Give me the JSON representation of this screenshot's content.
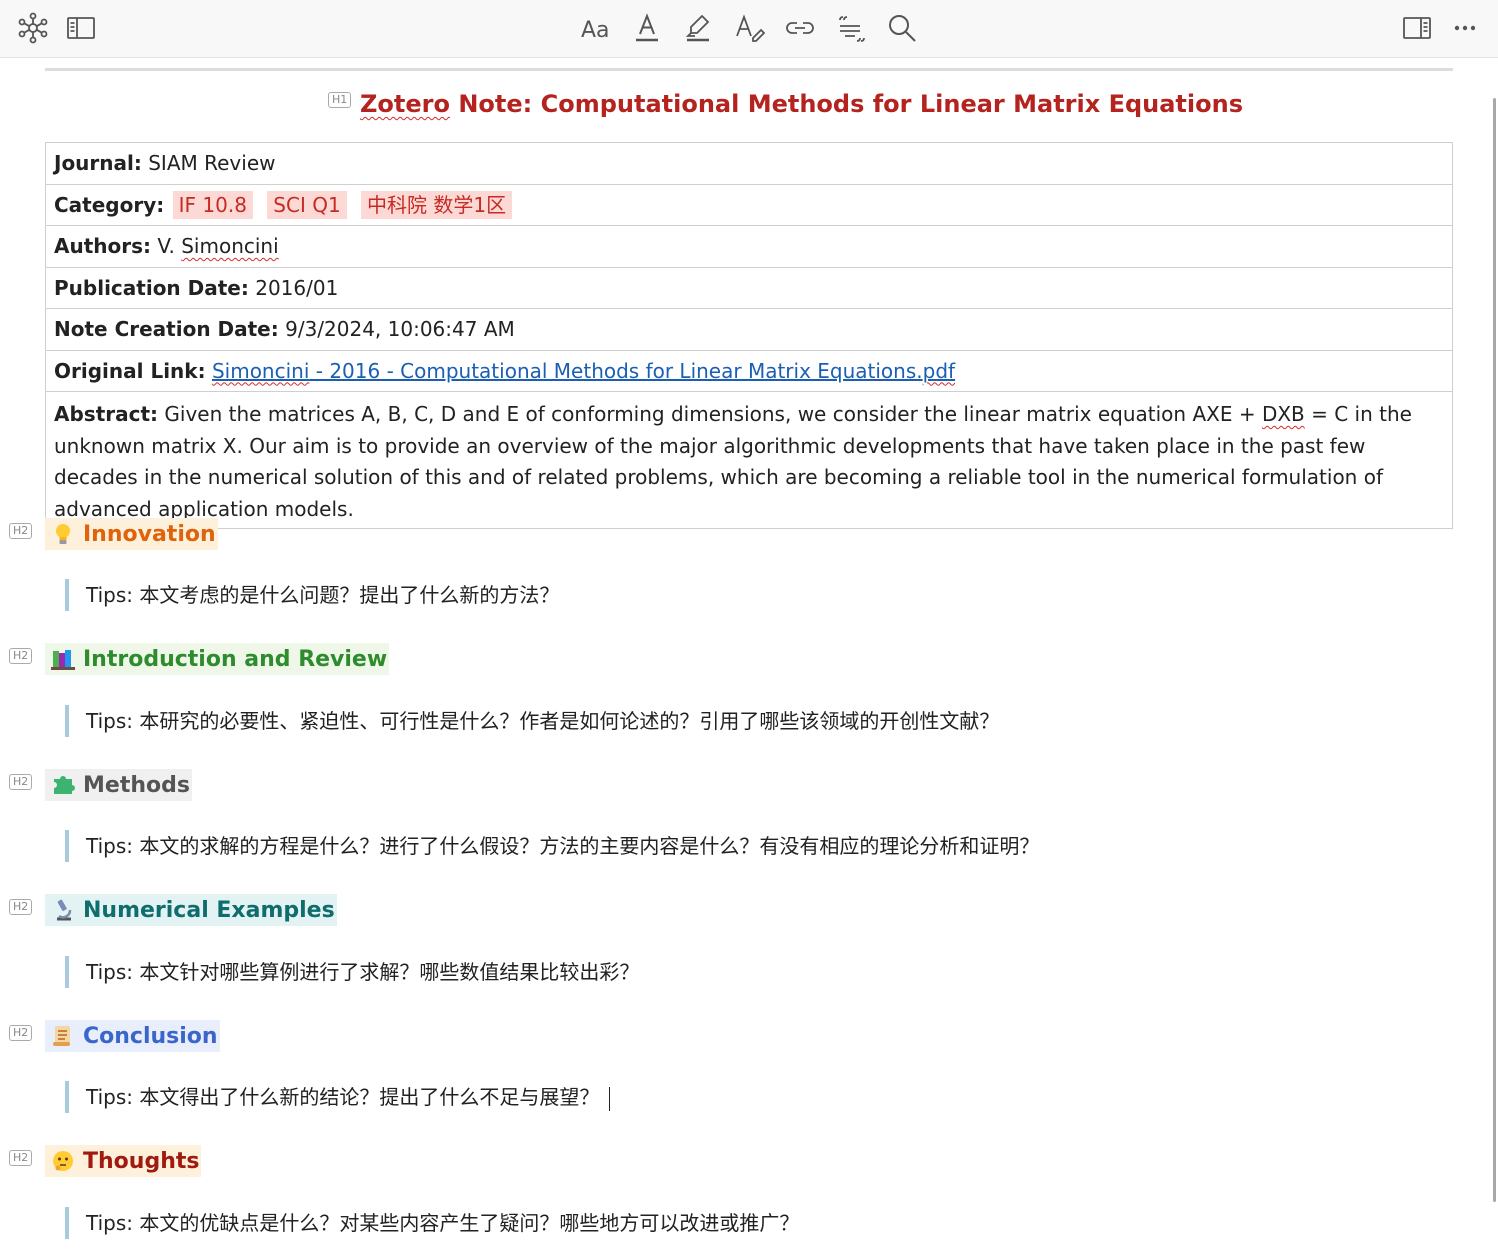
{
  "toolbar": {
    "left": [
      {
        "name": "graph-view-icon"
      },
      {
        "name": "sidebar-toggle-icon"
      }
    ],
    "center": [
      {
        "name": "text-size-icon"
      },
      {
        "name": "text-color-icon"
      },
      {
        "name": "highlight-icon"
      },
      {
        "name": "clear-format-icon"
      },
      {
        "name": "link-icon"
      },
      {
        "name": "citation-icon"
      },
      {
        "name": "search-icon"
      }
    ],
    "right": [
      {
        "name": "context-pane-icon"
      },
      {
        "name": "more-options-icon"
      }
    ]
  },
  "heading_labels": {
    "h1": "H1",
    "h2": "H2"
  },
  "title": {
    "word1": "Zotero",
    "rest": " Note: Computational Methods for Linear Matrix Equations",
    "color": "#b5231f"
  },
  "meta": {
    "journal_label": "Journal:",
    "journal": "SIAM Review",
    "category_label": "Category:",
    "category_tags": [
      "IF 10.8",
      "SCI Q1",
      "中科院 数学1区"
    ],
    "authors_label": "Authors:",
    "authors_prefix": "V. ",
    "authors_name": "Simoncini",
    "pubdate_label": "Publication Date:",
    "pubdate": "2016/01",
    "created_label": "Note Creation Date:",
    "created": "9/3/2024, 10:06:47 AM",
    "link_label": "Original Link:",
    "link_word1": "Simoncini",
    "link_rest": " - 2016 - Computational Methods for Linear Matrix Equations.",
    "link_ext": "pdf",
    "abstract_label": "Abstract:",
    "abstract_pre": " Given the matrices A, B, C, D and E of conforming dimensions, we consider the linear matrix equation AXE + ",
    "abstract_dxb": "DXB",
    "abstract_post": " = C in the unknown matrix X. Our aim is to provide an overview of the major algorithmic developments that have taken place in the past few decades in the numerical solution of this and of related problems, which are becoming a reliable tool in the numerical formulation of advanced application models."
  },
  "sections": [
    {
      "title": "Innovation",
      "icon": "lightbulb-icon",
      "color": "#e0620a",
      "bg": "#fdf1dc",
      "tip": "Tips: 本文考虑的是什么问题？提出了什么新的方法？"
    },
    {
      "title": "Introduction and Review",
      "icon": "books-icon",
      "color": "#2e8b2e",
      "bg": "#eef7e8",
      "tip": "Tips: 本研究的必要性、紧迫性、可行性是什么？作者是如何论述的？引用了哪些该领域的开创性文献？"
    },
    {
      "title": "Methods",
      "icon": "puzzle-icon",
      "color": "#555555",
      "bg": "#f0f0f0",
      "tip": "Tips: 本文的求解的方程是什么？进行了什么假设？方法的主要内容是什么？有没有相应的理论分析和证明？"
    },
    {
      "title": "Numerical Examples",
      "icon": "microscope-icon",
      "color": "#0f6d6d",
      "bg": "#e3f3f3",
      "tip": "Tips: 本文针对哪些算例进行了求解？哪些数值结果比较出彩？"
    },
    {
      "title": "Conclusion",
      "icon": "scroll-icon",
      "color": "#3a66cc",
      "bg": "#e8eefb",
      "tip": "Tips: 本文得出了什么新的结论？提出了什么不足与展望？"
    },
    {
      "title": "Thoughts",
      "icon": "thinking-face-icon",
      "color": "#a01a10",
      "bg": "#fdf1dc",
      "tip": "Tips: 本文的优缺点是什么？对某些内容产生了疑问？哪些地方可以改进或推广？"
    }
  ]
}
